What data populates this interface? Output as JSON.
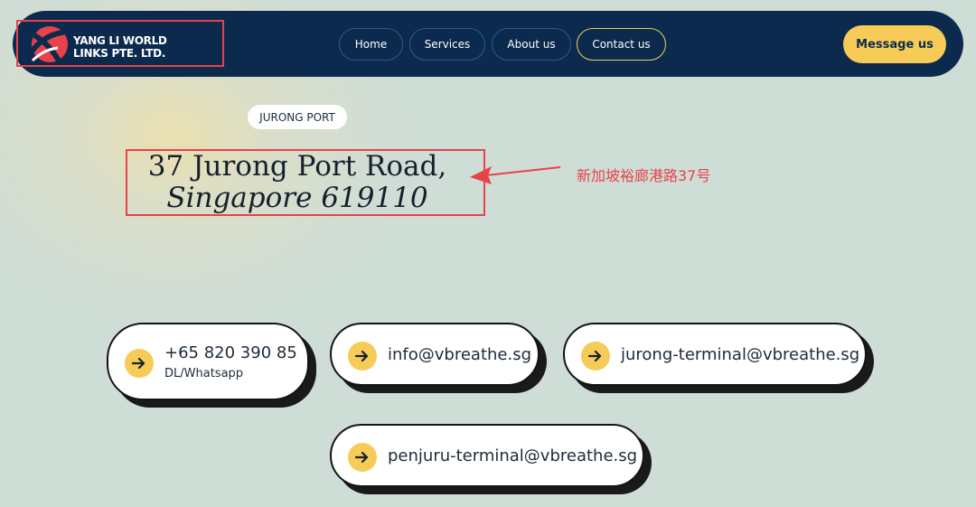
{
  "header": {
    "logo_line1": "YANG LI WORLD",
    "logo_line2": "LINKS PTE. LTD.",
    "nav": [
      {
        "label": "Home"
      },
      {
        "label": "Services"
      },
      {
        "label": "About us"
      },
      {
        "label": "Contact us"
      }
    ],
    "cta_label": "Message us"
  },
  "main": {
    "tag": "JURONG PORT",
    "address_line1": "37 Jurong Port Road,",
    "address_line2": "Singapore 619110",
    "annotation": "新加坡裕廊港路37号",
    "contacts": [
      {
        "text": "+65 820 390 85",
        "sub": "DL/Whatsapp",
        "icon": "arrow-right-icon"
      },
      {
        "text": "info@vbreathe.sg",
        "icon": "arrow-right-icon"
      },
      {
        "text": "jurong-terminal@vbreathe.sg",
        "icon": "arrow-right-icon"
      },
      {
        "text": "penjuru-terminal@vbreathe.sg",
        "icon": "arrow-right-icon"
      }
    ]
  },
  "colors": {
    "navy": "#0c2a4d",
    "accent_yellow": "#f6cb58",
    "annotation_red": "#e8424a",
    "background": "#cfddd7"
  }
}
